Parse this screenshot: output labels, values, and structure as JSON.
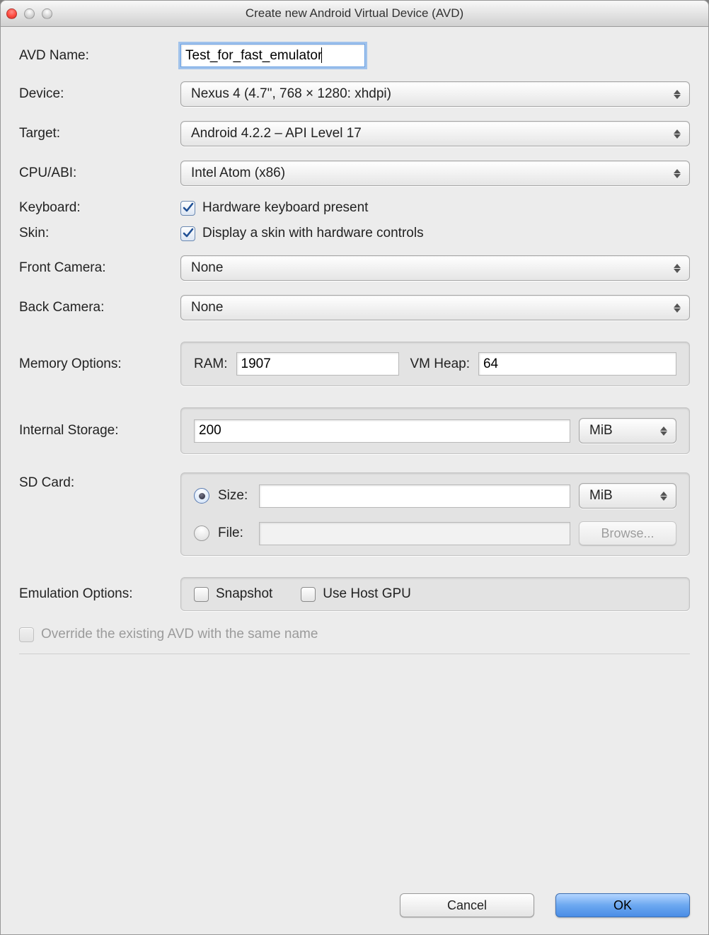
{
  "window": {
    "title": "Create new Android Virtual Device (AVD)"
  },
  "labels": {
    "avd_name": "AVD Name:",
    "device": "Device:",
    "target": "Target:",
    "cpu_abi": "CPU/ABI:",
    "keyboard": "Keyboard:",
    "skin": "Skin:",
    "front_camera": "Front Camera:",
    "back_camera": "Back Camera:",
    "memory_options": "Memory Options:",
    "internal_storage": "Internal Storage:",
    "sd_card": "SD Card:",
    "emulation_options": "Emulation Options:"
  },
  "fields": {
    "avd_name_value": "Test_for_fast_emulator",
    "device_value": "Nexus 4 (4.7\", 768 × 1280: xhdpi)",
    "target_value": "Android 4.2.2 – API Level 17",
    "cpu_abi_value": "Intel Atom (x86)",
    "keyboard_checkbox": "Hardware keyboard present",
    "skin_checkbox": "Display a skin with hardware controls",
    "front_camera_value": "None",
    "back_camera_value": "None",
    "ram_label": "RAM:",
    "ram_value": "1907",
    "heap_label": "VM Heap:",
    "heap_value": "64",
    "internal_storage_value": "200",
    "storage_unit": "MiB",
    "sd_size_label": "Size:",
    "sd_size_value": "",
    "sd_unit": "MiB",
    "sd_file_label": "File:",
    "sd_file_value": "",
    "browse_button": "Browse...",
    "snapshot_label": "Snapshot",
    "use_host_gpu_label": "Use Host GPU",
    "override_label": "Override the existing AVD with the same name"
  },
  "buttons": {
    "cancel": "Cancel",
    "ok": "OK"
  }
}
